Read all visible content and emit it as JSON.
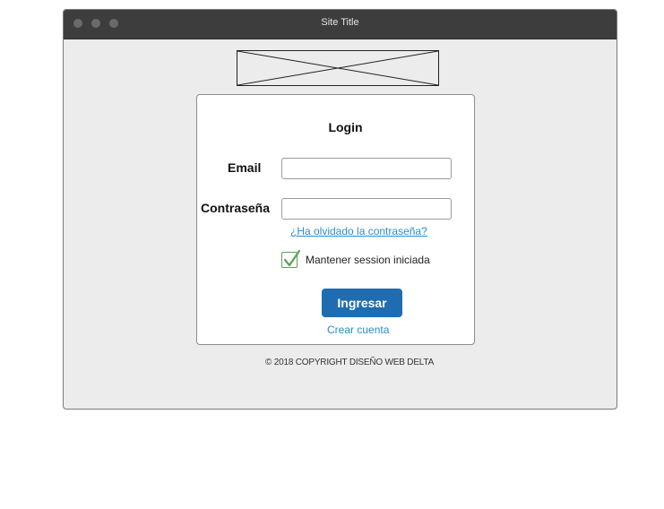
{
  "window": {
    "title": "Site Title"
  },
  "header": {
    "logo_placeholder": "image placeholder"
  },
  "login": {
    "title": "Login",
    "email_label": "Email",
    "email_value": "",
    "password_label": "Contraseña",
    "password_value": "",
    "forgot_link": "¿Ha olvidado la contraseña?",
    "remember_label": "Mantener session iniciada",
    "remember_checked": true,
    "submit_label": "Ingresar",
    "create_account_link": "Crear cuenta"
  },
  "footer": {
    "copyright": "© 2018 COPYRIGHT DISEÑO WEB DELTA"
  },
  "colors": {
    "titlebar": "#3d3d3d",
    "window_bg": "#ececec",
    "button": "#1f6db0",
    "link": "#2a8ec9",
    "check": "#5aa05a"
  }
}
